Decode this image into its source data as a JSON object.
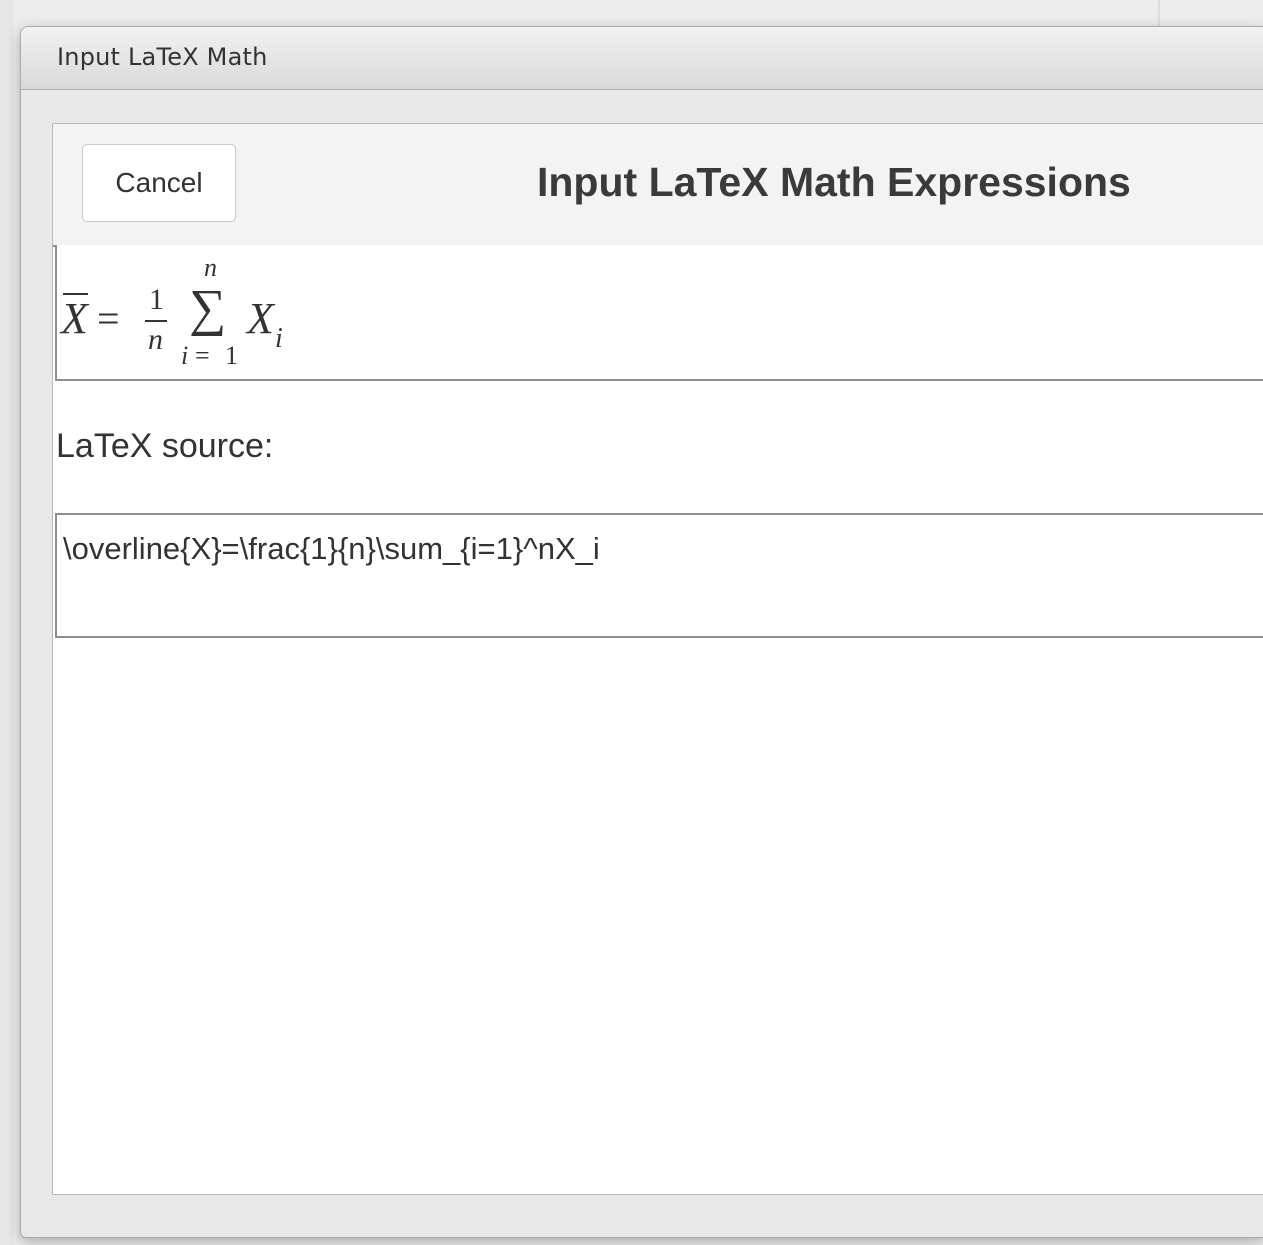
{
  "window": {
    "title": "Input LaTeX Math"
  },
  "dialog": {
    "cancel_label": "Cancel",
    "title": "Input LaTeX Math Expressions"
  },
  "preview": {
    "formula": {
      "lhs": "X",
      "equals": "=",
      "numerator": "1",
      "denominator": "n",
      "sum_symbol": "∑",
      "sum_upper": "n",
      "sum_lower_var": "i",
      "sum_lower_eq": "=",
      "sum_lower_val": "1",
      "term": "X",
      "term_sub": "i"
    }
  },
  "source": {
    "label": "LaTeX source:",
    "value": "\\overline{X}=\\frac{1}{n}\\sum_{i=1}^nX_i"
  }
}
